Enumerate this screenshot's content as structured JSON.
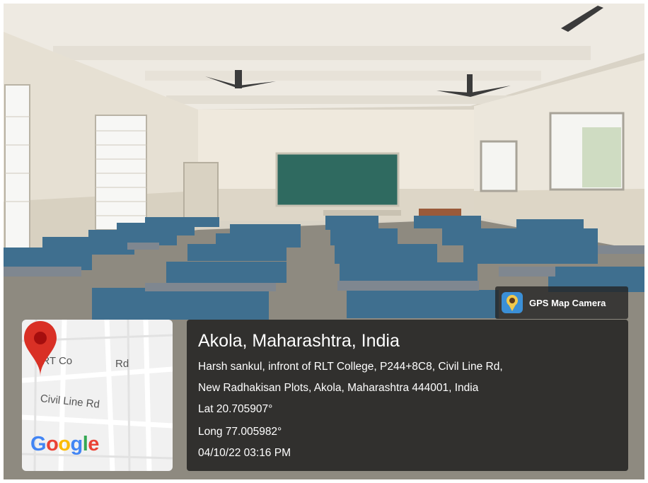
{
  "image": {
    "subject": "empty classroom",
    "colors": {
      "benches": "#3f6f8f",
      "chalkboard": "#2f6a60",
      "walls": "#e9e3d6",
      "overlay": "#1c1c1c"
    }
  },
  "badge": {
    "label": "GPS Map Camera",
    "icon": "camera-pin-icon"
  },
  "map": {
    "road_labels": [
      "LRT Co",
      "Rd",
      "Civil Line Rd"
    ],
    "brand": "Google",
    "pin_icon": "map-pin-icon",
    "pin_color": "#d93025"
  },
  "location": {
    "title": "Akola, Maharashtra, India",
    "address_line1": "Harsh sankul, infront of RLT College, P244+8C8, Civil Line Rd,",
    "address_line2": "New Radhakisan Plots, Akola, Maharashtra 444001, India",
    "lat": "Lat 20.705907°",
    "long": "Long 77.005982°",
    "datetime": "04/10/22 03:16 PM"
  }
}
